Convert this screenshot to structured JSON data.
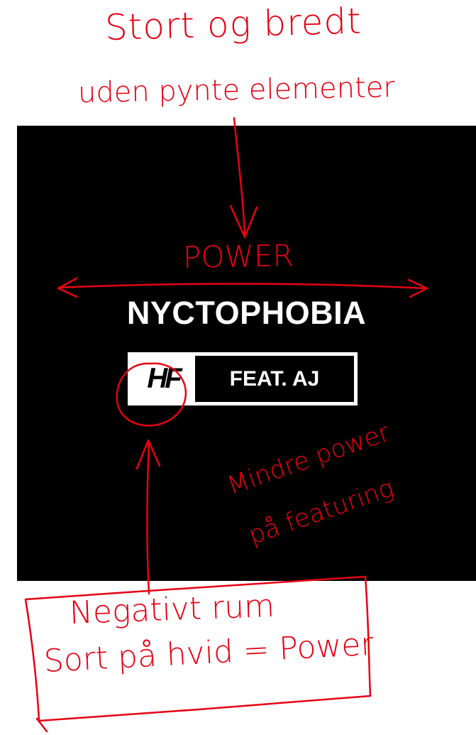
{
  "annotations": {
    "top_line1": "Stort og bredt",
    "top_line2": "uden pynte elementer",
    "power": "POWER",
    "featuring_line1": "Mindre power",
    "featuring_line2": "på featuring",
    "box_line1": "Negativt rum",
    "box_line2": "Sort på hvid = Power"
  },
  "album_cover": {
    "title": "NYCTOPHOBIA",
    "logo_text": "HF",
    "feat_label": "FEAT. AJ"
  },
  "colors": {
    "annotation": "#e60012",
    "cover_background": "#000000",
    "cover_text": "#ffffff",
    "page_background": "#ffffff"
  }
}
